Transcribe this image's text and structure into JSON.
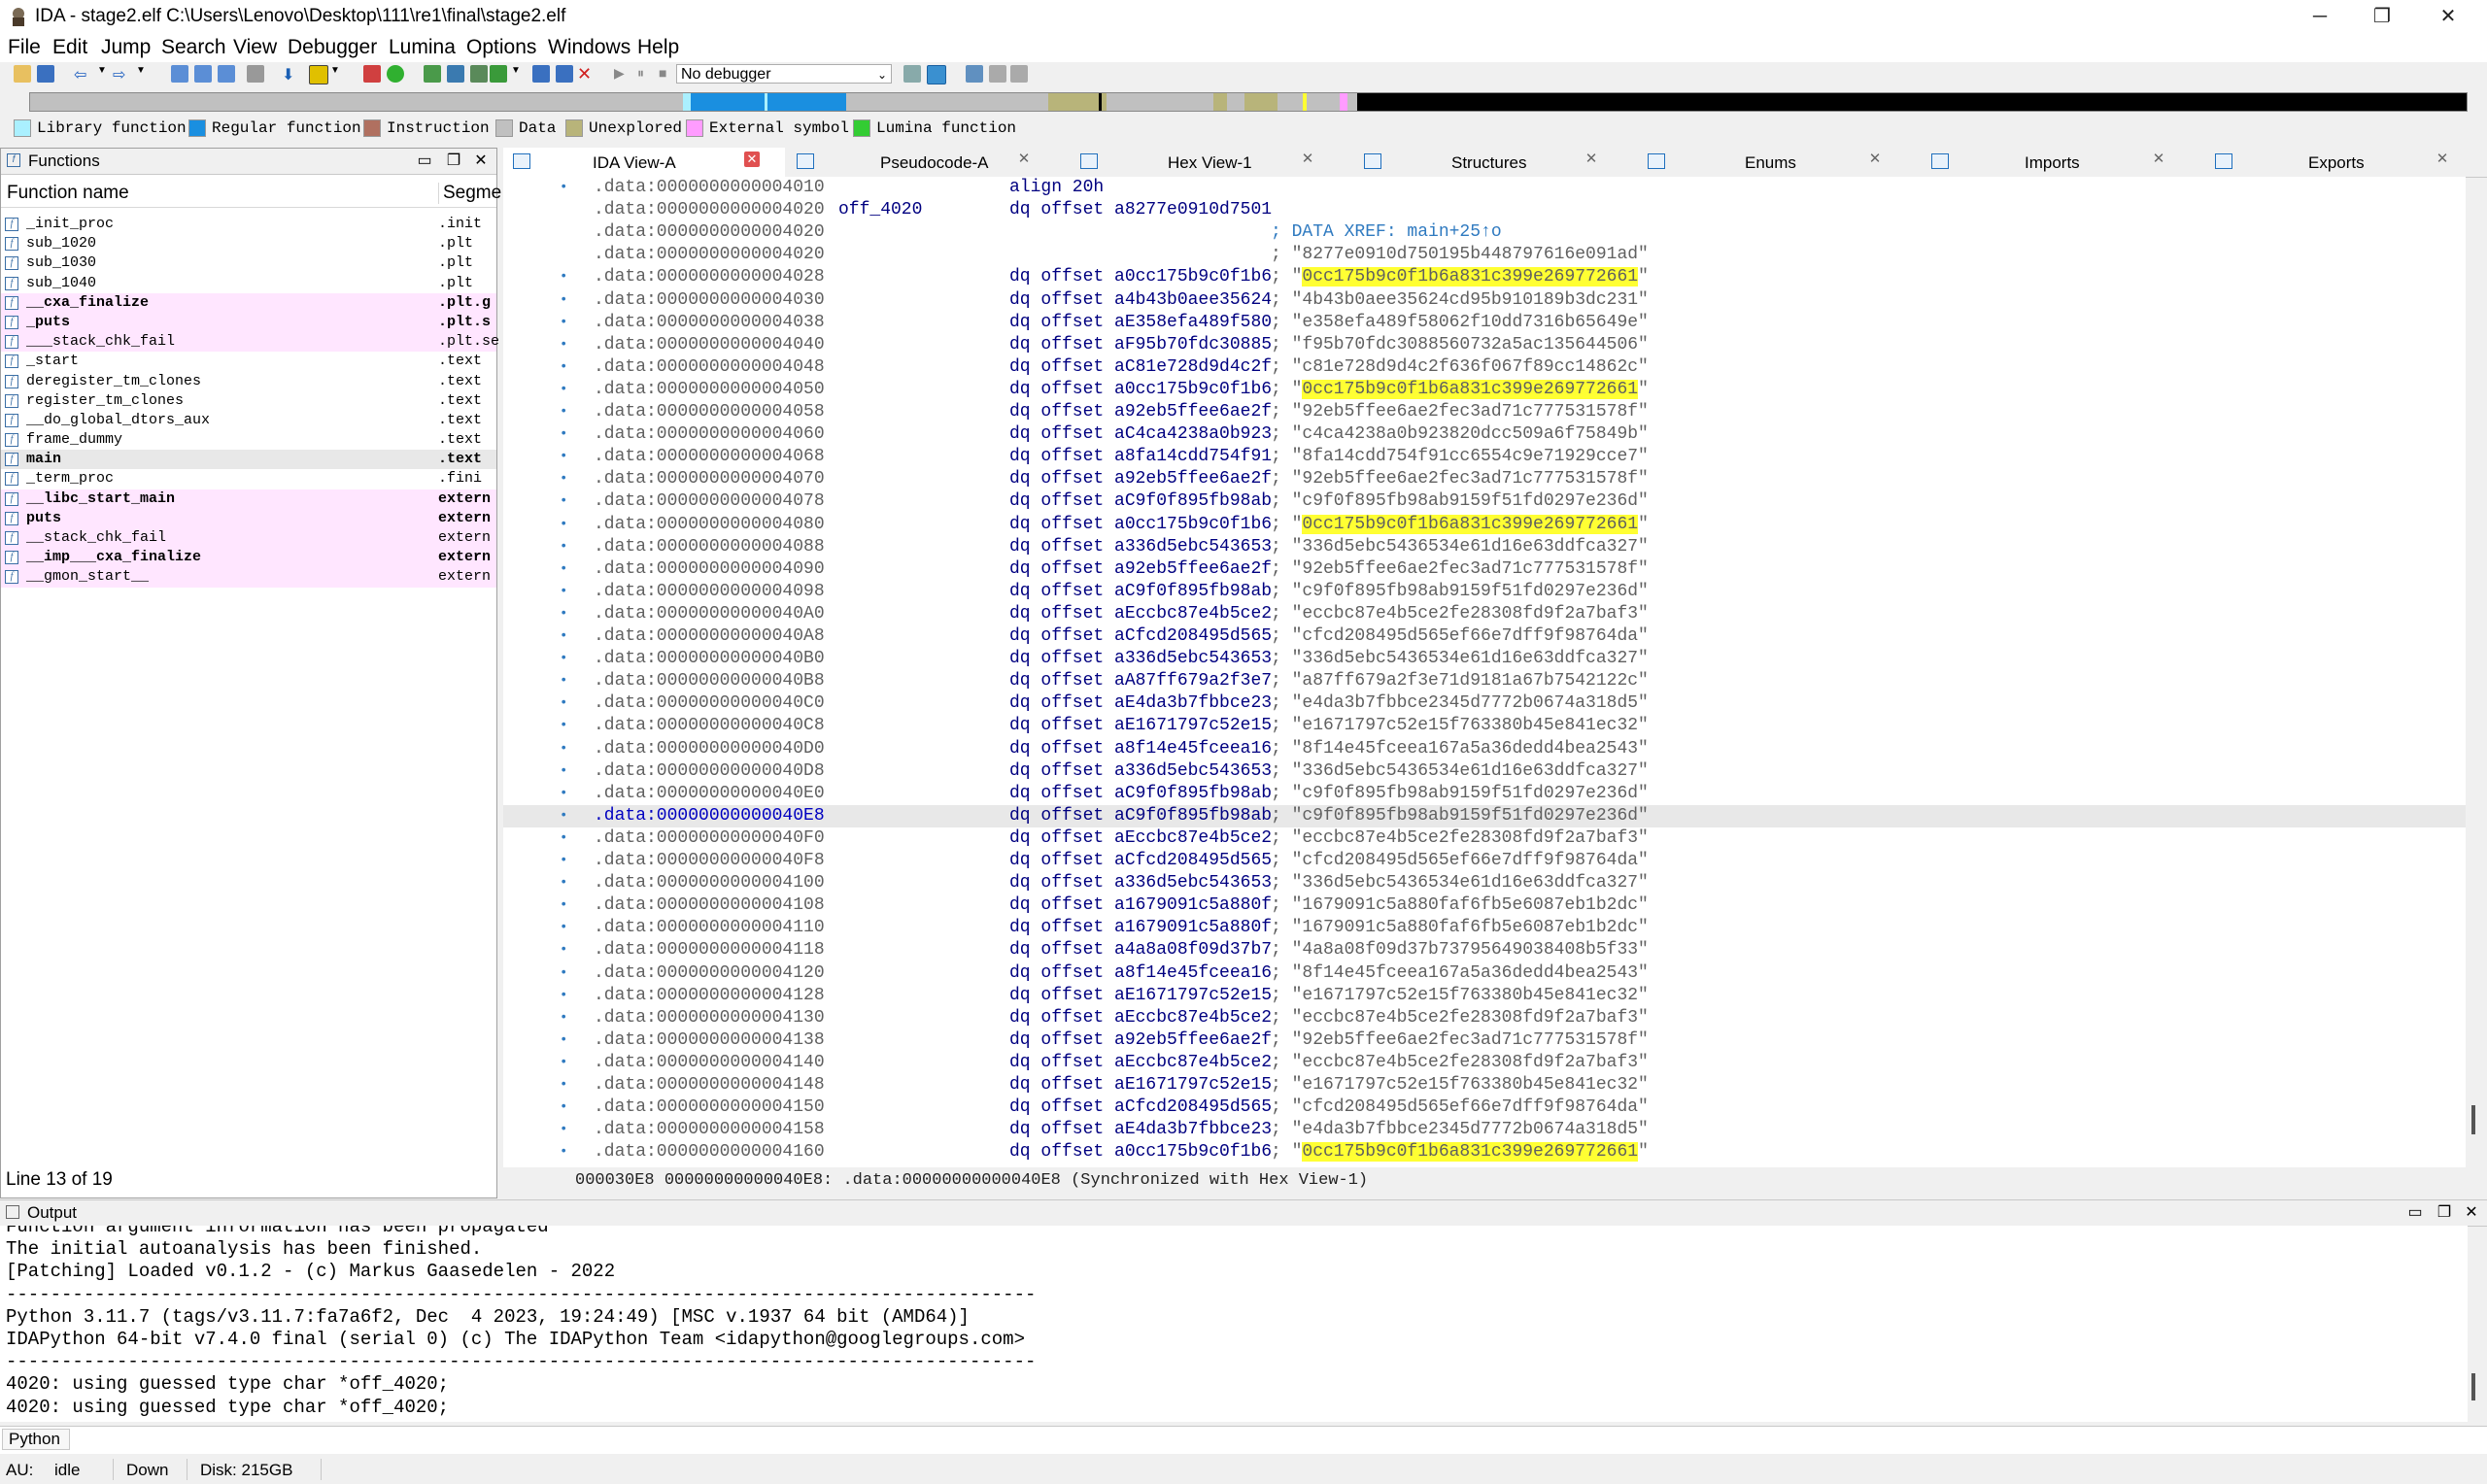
{
  "window": {
    "title": "IDA - stage2.elf C:\\Users\\Lenovo\\Desktop\\111\\re1\\final\\stage2.elf",
    "minimize": "─",
    "maximize": "❐",
    "close": "✕"
  },
  "menu": [
    "File",
    "Edit",
    "Jump",
    "Search",
    "View",
    "Debugger",
    "Lumina",
    "Options",
    "Windows",
    "Help"
  ],
  "toolbar": {
    "debugger_select": "No debugger"
  },
  "legend": [
    {
      "label": "Library function",
      "color": "#aaf0ff"
    },
    {
      "label": "Regular function",
      "color": "#1a8fe0"
    },
    {
      "label": "Instruction",
      "color": "#b07060"
    },
    {
      "label": "Data",
      "color": "#c0c0c0"
    },
    {
      "label": "Unexplored",
      "color": "#b8b47a"
    },
    {
      "label": "External symbol",
      "color": "#ff9cff"
    },
    {
      "label": "Lumina function",
      "color": "#33cc33"
    }
  ],
  "functions_panel": {
    "title": "Functions",
    "col_name": "Function name",
    "col_segment": "Segme",
    "status": "Line 13 of 19",
    "rows": [
      {
        "name": "_init_proc",
        "seg": ".init",
        "lib": false,
        "bold": false
      },
      {
        "name": "sub_1020",
        "seg": ".plt",
        "lib": false,
        "bold": false
      },
      {
        "name": "sub_1030",
        "seg": ".plt",
        "lib": false,
        "bold": false
      },
      {
        "name": "sub_1040",
        "seg": ".plt",
        "lib": false,
        "bold": false
      },
      {
        "name": "__cxa_finalize",
        "seg": ".plt.g",
        "lib": true,
        "bold": true
      },
      {
        "name": "_puts",
        "seg": ".plt.s",
        "lib": true,
        "bold": true
      },
      {
        "name": "___stack_chk_fail",
        "seg": ".plt.se",
        "lib": true,
        "bold": false
      },
      {
        "name": "_start",
        "seg": ".text",
        "lib": false,
        "bold": false
      },
      {
        "name": "deregister_tm_clones",
        "seg": ".text",
        "lib": false,
        "bold": false
      },
      {
        "name": "register_tm_clones",
        "seg": ".text",
        "lib": false,
        "bold": false
      },
      {
        "name": "__do_global_dtors_aux",
        "seg": ".text",
        "lib": false,
        "bold": false
      },
      {
        "name": "frame_dummy",
        "seg": ".text",
        "lib": false,
        "bold": false
      },
      {
        "name": "main",
        "seg": ".text",
        "lib": false,
        "bold": true,
        "selected": true
      },
      {
        "name": "_term_proc",
        "seg": ".fini",
        "lib": false,
        "bold": false
      },
      {
        "name": "__libc_start_main",
        "seg": "extern",
        "lib": true,
        "bold": true
      },
      {
        "name": "puts",
        "seg": "extern",
        "lib": true,
        "bold": true
      },
      {
        "name": "__stack_chk_fail",
        "seg": "extern",
        "lib": true,
        "bold": false
      },
      {
        "name": "__imp___cxa_finalize",
        "seg": "extern",
        "lib": true,
        "bold": true
      },
      {
        "name": "__gmon_start__",
        "seg": "extern",
        "lib": true,
        "bold": false
      }
    ]
  },
  "tabs": [
    "IDA View-A",
    "Pseudocode-A",
    "Hex View-1",
    "Structures",
    "Enums",
    "Imports",
    "Exports"
  ],
  "disasm": {
    "rows": [
      {
        "addr": ".data:0000000000004010",
        "label": "",
        "ins": "align 20h",
        "cmt": "",
        "dot": true
      },
      {
        "addr": ".data:0000000000004020",
        "label": "off_4020",
        "ins": "dq offset a8277e0910d7501",
        "cmt": "",
        "dot": false
      },
      {
        "addr": ".data:0000000000004020",
        "label": "",
        "ins": "",
        "cmt": "; DATA XREF: main+25↑o",
        "xref": true,
        "dot": false
      },
      {
        "addr": ".data:0000000000004020",
        "label": "",
        "ins": "",
        "cmt": "; \"8277e0910d750195b448797616e091ad\"",
        "dot": false
      },
      {
        "addr": ".data:0000000000004028",
        "label": "",
        "ins": "dq offset a0cc175b9c0f1b6",
        "cmt": "; \"",
        "hl": "0cc175b9c0f1b6a831c399e269772661",
        "dot": true
      },
      {
        "addr": ".data:0000000000004030",
        "label": "",
        "ins": "dq offset a4b43b0aee35624",
        "cmt": "; \"4b43b0aee35624cd95b910189b3dc231\"",
        "dot": true
      },
      {
        "addr": ".data:0000000000004038",
        "label": "",
        "ins": "dq offset aE358efa489f580",
        "cmt": "; \"e358efa489f58062f10dd7316b65649e\"",
        "dot": true
      },
      {
        "addr": ".data:0000000000004040",
        "label": "",
        "ins": "dq offset aF95b70fdc30885",
        "cmt": "; \"f95b70fdc3088560732a5ac135644506\"",
        "dot": true
      },
      {
        "addr": ".data:0000000000004048",
        "label": "",
        "ins": "dq offset aC81e728d9d4c2f",
        "cmt": "; \"c81e728d9d4c2f636f067f89cc14862c\"",
        "dot": true
      },
      {
        "addr": ".data:0000000000004050",
        "label": "",
        "ins": "dq offset a0cc175b9c0f1b6",
        "cmt": "; \"",
        "hl": "0cc175b9c0f1b6a831c399e269772661",
        "dot": true
      },
      {
        "addr": ".data:0000000000004058",
        "label": "",
        "ins": "dq offset a92eb5ffee6ae2f",
        "cmt": "; \"92eb5ffee6ae2fec3ad71c777531578f\"",
        "dot": true
      },
      {
        "addr": ".data:0000000000004060",
        "label": "",
        "ins": "dq offset aC4ca4238a0b923",
        "cmt": "; \"c4ca4238a0b923820dcc509a6f75849b\"",
        "dot": true
      },
      {
        "addr": ".data:0000000000004068",
        "label": "",
        "ins": "dq offset a8fa14cdd754f91",
        "cmt": "; \"8fa14cdd754f91cc6554c9e71929cce7\"",
        "dot": true
      },
      {
        "addr": ".data:0000000000004070",
        "label": "",
        "ins": "dq offset a92eb5ffee6ae2f",
        "cmt": "; \"92eb5ffee6ae2fec3ad71c777531578f\"",
        "dot": true
      },
      {
        "addr": ".data:0000000000004078",
        "label": "",
        "ins": "dq offset aC9f0f895fb98ab",
        "cmt": "; \"c9f0f895fb98ab9159f51fd0297e236d\"",
        "dot": true
      },
      {
        "addr": ".data:0000000000004080",
        "label": "",
        "ins": "dq offset a0cc175b9c0f1b6",
        "cmt": "; \"",
        "hl": "0cc175b9c0f1b6a831c399e269772661",
        "dot": true
      },
      {
        "addr": ".data:0000000000004088",
        "label": "",
        "ins": "dq offset a336d5ebc543653",
        "cmt": "; \"336d5ebc5436534e61d16e63ddfca327\"",
        "dot": true
      },
      {
        "addr": ".data:0000000000004090",
        "label": "",
        "ins": "dq offset a92eb5ffee6ae2f",
        "cmt": "; \"92eb5ffee6ae2fec3ad71c777531578f\"",
        "dot": true
      },
      {
        "addr": ".data:0000000000004098",
        "label": "",
        "ins": "dq offset aC9f0f895fb98ab",
        "cmt": "; \"c9f0f895fb98ab9159f51fd0297e236d\"",
        "dot": true
      },
      {
        "addr": ".data:00000000000040A0",
        "label": "",
        "ins": "dq offset aEccbc87e4b5ce2",
        "cmt": "; \"eccbc87e4b5ce2fe28308fd9f2a7baf3\"",
        "dot": true
      },
      {
        "addr": ".data:00000000000040A8",
        "label": "",
        "ins": "dq offset aCfcd208495d565",
        "cmt": "; \"cfcd208495d565ef66e7dff9f98764da\"",
        "dot": true
      },
      {
        "addr": ".data:00000000000040B0",
        "label": "",
        "ins": "dq offset a336d5ebc543653",
        "cmt": "; \"336d5ebc5436534e61d16e63ddfca327\"",
        "dot": true
      },
      {
        "addr": ".data:00000000000040B8",
        "label": "",
        "ins": "dq offset aA87ff679a2f3e7",
        "cmt": "; \"a87ff679a2f3e71d9181a67b7542122c\"",
        "dot": true
      },
      {
        "addr": ".data:00000000000040C0",
        "label": "",
        "ins": "dq offset aE4da3b7fbbce23",
        "cmt": "; \"e4da3b7fbbce2345d7772b0674a318d5\"",
        "dot": true
      },
      {
        "addr": ".data:00000000000040C8",
        "label": "",
        "ins": "dq offset aE1671797c52e15",
        "cmt": "; \"e1671797c52e15f763380b45e841ec32\"",
        "dot": true
      },
      {
        "addr": ".data:00000000000040D0",
        "label": "",
        "ins": "dq offset a8f14e45fceea16",
        "cmt": "; \"8f14e45fceea167a5a36dedd4bea2543\"",
        "dot": true
      },
      {
        "addr": ".data:00000000000040D8",
        "label": "",
        "ins": "dq offset a336d5ebc543653",
        "cmt": "; \"336d5ebc5436534e61d16e63ddfca327\"",
        "dot": true
      },
      {
        "addr": ".data:00000000000040E0",
        "label": "",
        "ins": "dq offset aC9f0f895fb98ab",
        "cmt": "; \"c9f0f895fb98ab9159f51fd0297e236d\"",
        "dot": true
      },
      {
        "addr": ".data:00000000000040E8",
        "label": "",
        "ins": "dq offset aC9f0f895fb98ab",
        "cmt": "; \"c9f0f895fb98ab9159f51fd0297e236d\"",
        "dot": true,
        "current": true
      },
      {
        "addr": ".data:00000000000040F0",
        "label": "",
        "ins": "dq offset aEccbc87e4b5ce2",
        "cmt": "; \"eccbc87e4b5ce2fe28308fd9f2a7baf3\"",
        "dot": true
      },
      {
        "addr": ".data:00000000000040F8",
        "label": "",
        "ins": "dq offset aCfcd208495d565",
        "cmt": "; \"cfcd208495d565ef66e7dff9f98764da\"",
        "dot": true
      },
      {
        "addr": ".data:0000000000004100",
        "label": "",
        "ins": "dq offset a336d5ebc543653",
        "cmt": "; \"336d5ebc5436534e61d16e63ddfca327\"",
        "dot": true
      },
      {
        "addr": ".data:0000000000004108",
        "label": "",
        "ins": "dq offset a1679091c5a880f",
        "cmt": "; \"1679091c5a880faf6fb5e6087eb1b2dc\"",
        "dot": true
      },
      {
        "addr": ".data:0000000000004110",
        "label": "",
        "ins": "dq offset a1679091c5a880f",
        "cmt": "; \"1679091c5a880faf6fb5e6087eb1b2dc\"",
        "dot": true
      },
      {
        "addr": ".data:0000000000004118",
        "label": "",
        "ins": "dq offset a4a8a08f09d37b7",
        "cmt": "; \"4a8a08f09d37b73795649038408b5f33\"",
        "dot": true
      },
      {
        "addr": ".data:0000000000004120",
        "label": "",
        "ins": "dq offset a8f14e45fceea16",
        "cmt": "; \"8f14e45fceea167a5a36dedd4bea2543\"",
        "dot": true
      },
      {
        "addr": ".data:0000000000004128",
        "label": "",
        "ins": "dq offset aE1671797c52e15",
        "cmt": "; \"e1671797c52e15f763380b45e841ec32\"",
        "dot": true
      },
      {
        "addr": ".data:0000000000004130",
        "label": "",
        "ins": "dq offset aEccbc87e4b5ce2",
        "cmt": "; \"eccbc87e4b5ce2fe28308fd9f2a7baf3\"",
        "dot": true
      },
      {
        "addr": ".data:0000000000004138",
        "label": "",
        "ins": "dq offset a92eb5ffee6ae2f",
        "cmt": "; \"92eb5ffee6ae2fec3ad71c777531578f\"",
        "dot": true
      },
      {
        "addr": ".data:0000000000004140",
        "label": "",
        "ins": "dq offset aEccbc87e4b5ce2",
        "cmt": "; \"eccbc87e4b5ce2fe28308fd9f2a7baf3\"",
        "dot": true
      },
      {
        "addr": ".data:0000000000004148",
        "label": "",
        "ins": "dq offset aE1671797c52e15",
        "cmt": "; \"e1671797c52e15f763380b45e841ec32\"",
        "dot": true
      },
      {
        "addr": ".data:0000000000004150",
        "label": "",
        "ins": "dq offset aCfcd208495d565",
        "cmt": "; \"cfcd208495d565ef66e7dff9f98764da\"",
        "dot": true
      },
      {
        "addr": ".data:0000000000004158",
        "label": "",
        "ins": "dq offset aE4da3b7fbbce23",
        "cmt": "; \"e4da3b7fbbce2345d7772b0674a318d5\"",
        "dot": true
      },
      {
        "addr": ".data:0000000000004160",
        "label": "",
        "ins": "dq offset a0cc175b9c0f1b6",
        "cmt": "; \"",
        "hl": "0cc175b9c0f1b6a831c399e269772661",
        "dot": true
      }
    ],
    "status": "000030E8 00000000000040E8: .data:00000000000040E8 (Synchronized with Hex View-1)"
  },
  "output": {
    "title": "Output",
    "lines": [
      "Function argument information has been propagated",
      "The initial autoanalysis has been finished.",
      "[Patching] Loaded v0.1.2 - (c) Markus Gaasedelen - 2022",
      "---------------------------------------------------------------------------------------------",
      "Python 3.11.7 (tags/v3.11.7:fa7a6f2, Dec  4 2023, 19:24:49) [MSC v.1937 64 bit (AMD64)]",
      "IDAPython 64-bit v7.4.0 final (serial 0) (c) The IDAPython Team <idapython@googlegroups.com>",
      "---------------------------------------------------------------------------------------------",
      "4020: using guessed type char *off_4020;",
      "4020: using guessed type char *off_4020;"
    ],
    "cli_button": "Python"
  },
  "statusbar": {
    "au": "AU:",
    "state": "idle",
    "direction": "Down",
    "disk": "Disk: 215GB"
  }
}
